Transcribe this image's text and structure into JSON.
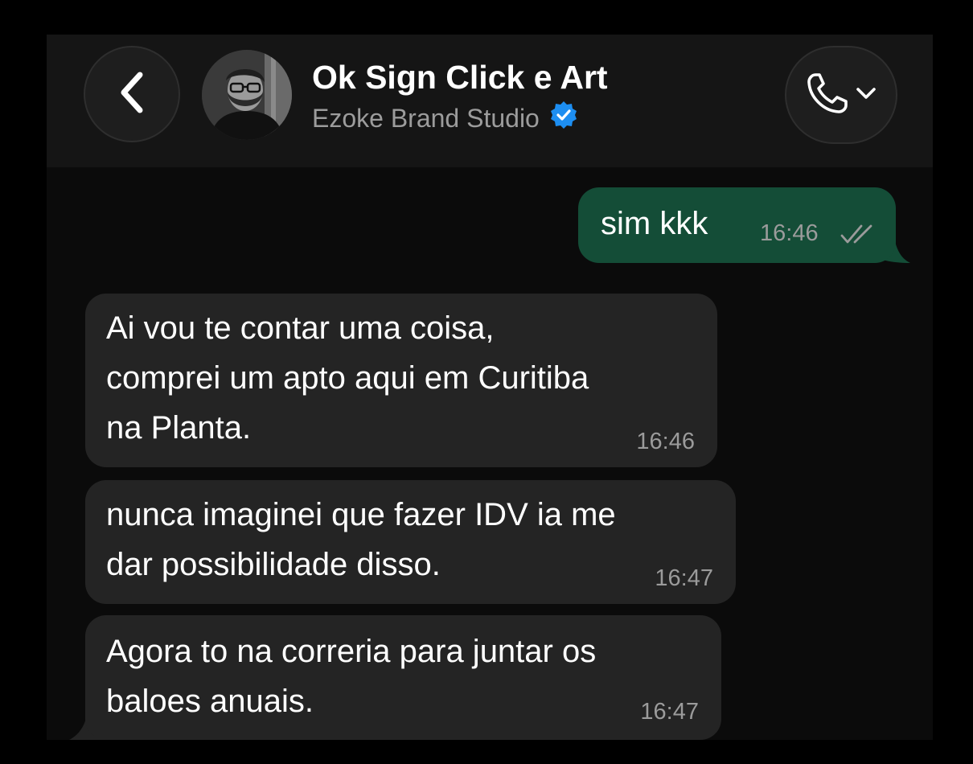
{
  "header": {
    "title": "Ok Sign Click e Art",
    "subtitle": "Ezoke Brand Studio",
    "back_icon": "chevron-left-icon",
    "verified_icon": "verified-badge-icon",
    "call_icon": "phone-icon",
    "call_menu_icon": "chevron-down-icon"
  },
  "messages": [
    {
      "direction": "outgoing",
      "text": "sim kkk",
      "time": "16:46",
      "status_icon": "double-check-icon"
    },
    {
      "direction": "incoming",
      "text": "Ai vou te contar uma coisa,\ncomprei um apto aqui em Curitiba\nna Planta.",
      "time": "16:46"
    },
    {
      "direction": "incoming",
      "text": "nunca imaginei que fazer IDV ia me\ndar possibilidade disso.",
      "time": "16:47"
    },
    {
      "direction": "incoming",
      "text": "Agora to na correria para juntar os\nbaloes anuais.",
      "time": "16:47"
    }
  ],
  "colors": {
    "outgoing_bubble": "#144d37",
    "incoming_bubble": "#242424",
    "verified_badge": "#1d8ef1",
    "read_ticks": "#9b9b9b"
  }
}
